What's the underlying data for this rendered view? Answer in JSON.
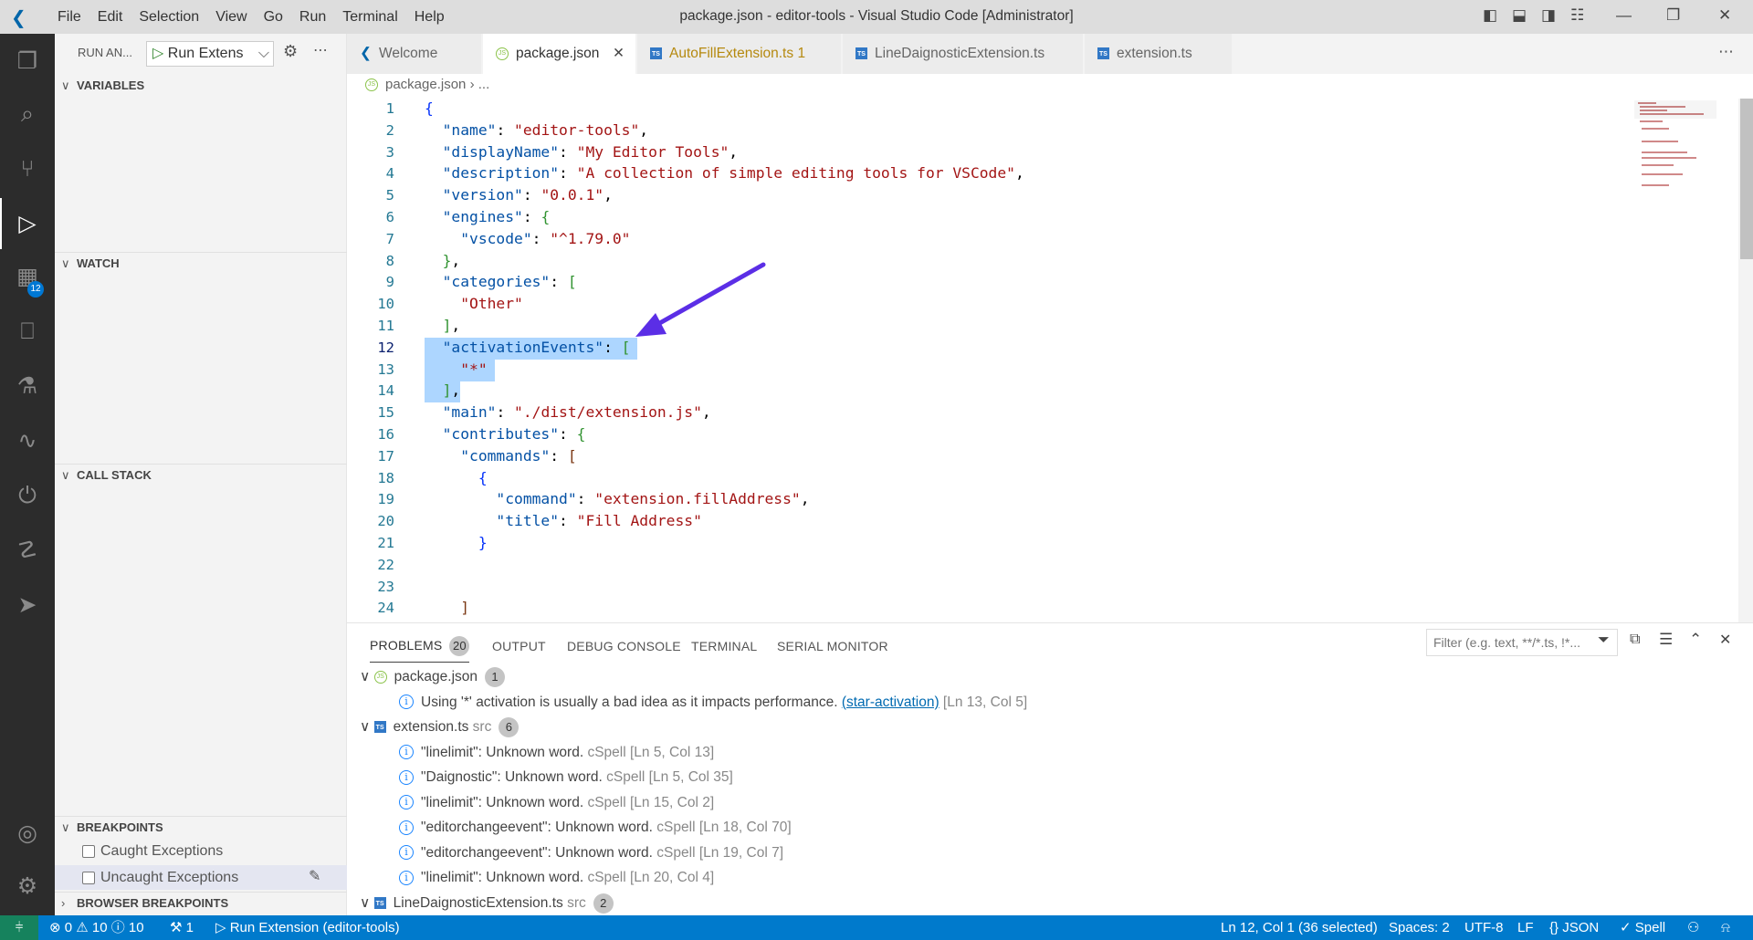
{
  "titlebar": {
    "menu": [
      "File",
      "Edit",
      "Selection",
      "View",
      "Go",
      "Run",
      "Terminal",
      "Help"
    ],
    "title": "package.json - editor-tools - Visual Studio Code [Administrator]"
  },
  "activity_bar": {
    "extensions_badge": "12",
    "items": [
      "explorer",
      "search",
      "source-control",
      "run-debug",
      "extensions",
      "remote-explorer",
      "testing",
      "serial",
      "power",
      "python",
      "deploy",
      "accounts",
      "settings"
    ]
  },
  "sidebar": {
    "title": "RUN AN...",
    "config": "Run Extens",
    "sections": {
      "variables": "VARIABLES",
      "watch": "WATCH",
      "call_stack": "CALL STACK",
      "breakpoints": "BREAKPOINTS",
      "browser_breakpoints": "BROWSER BREAKPOINTS"
    },
    "breakpoints": [
      {
        "label": "Caught Exceptions",
        "checked": false
      },
      {
        "label": "Uncaught Exceptions",
        "checked": false
      }
    ]
  },
  "tabs": [
    {
      "label": "Welcome",
      "icon": "vscode",
      "active": false
    },
    {
      "label": "package.json",
      "icon": "json",
      "active": true
    },
    {
      "label": "AutoFillExtension.ts",
      "badge": "1",
      "icon": "ts",
      "active": false
    },
    {
      "label": "LineDaignosticExtension.ts",
      "icon": "ts",
      "active": false
    },
    {
      "label": "extension.ts",
      "icon": "ts",
      "active": false
    }
  ],
  "breadcrumb": {
    "file": "package.json",
    "rest": "..."
  },
  "editor": {
    "current_line": 12,
    "selected_lines": [
      12,
      13,
      14
    ],
    "lines": [
      [
        [
          "{",
          "b1"
        ]
      ],
      [
        [
          "  ",
          ""
        ],
        [
          "\"name\"",
          "k"
        ],
        [
          ": ",
          ""
        ],
        [
          "\"editor-tools\"",
          "s"
        ],
        [
          ",",
          ""
        ]
      ],
      [
        [
          "  ",
          ""
        ],
        [
          "\"displayName\"",
          "k"
        ],
        [
          ": ",
          ""
        ],
        [
          "\"My Editor Tools\"",
          "s"
        ],
        [
          ",",
          ""
        ]
      ],
      [
        [
          "  ",
          ""
        ],
        [
          "\"description\"",
          "k"
        ],
        [
          ": ",
          ""
        ],
        [
          "\"A collection of simple editing tools for VSCode\"",
          "s"
        ],
        [
          ",",
          ""
        ]
      ],
      [
        [
          "  ",
          ""
        ],
        [
          "\"version\"",
          "k"
        ],
        [
          ": ",
          ""
        ],
        [
          "\"0.0.1\"",
          "s"
        ],
        [
          ",",
          ""
        ]
      ],
      [
        [
          "  ",
          ""
        ],
        [
          "\"engines\"",
          "k"
        ],
        [
          ": ",
          ""
        ],
        [
          "{",
          "b2"
        ]
      ],
      [
        [
          "    ",
          ""
        ],
        [
          "\"vscode\"",
          "k"
        ],
        [
          ": ",
          ""
        ],
        [
          "\"^1.79.0\"",
          "s"
        ]
      ],
      [
        [
          "  ",
          ""
        ],
        [
          "}",
          "b2"
        ],
        [
          ",",
          ""
        ]
      ],
      [
        [
          "  ",
          ""
        ],
        [
          "\"categories\"",
          "k"
        ],
        [
          ": ",
          ""
        ],
        [
          "[",
          "b2"
        ]
      ],
      [
        [
          "    ",
          ""
        ],
        [
          "\"Other\"",
          "s"
        ]
      ],
      [
        [
          "  ",
          ""
        ],
        [
          "]",
          "b2"
        ],
        [
          ",",
          ""
        ]
      ],
      [
        [
          "  ",
          ""
        ],
        [
          "\"activationEvents\"",
          "k"
        ],
        [
          ": ",
          ""
        ],
        [
          "[",
          "b2"
        ]
      ],
      [
        [
          "    ",
          ""
        ],
        [
          "\"*\"",
          "s"
        ]
      ],
      [
        [
          "  ",
          ""
        ],
        [
          "]",
          "b2"
        ],
        [
          ",",
          ""
        ]
      ],
      [
        [
          "  ",
          ""
        ],
        [
          "\"main\"",
          "k"
        ],
        [
          ": ",
          ""
        ],
        [
          "\"./dist/extension.js\"",
          "s"
        ],
        [
          ",",
          ""
        ]
      ],
      [
        [
          "  ",
          ""
        ],
        [
          "\"contributes\"",
          "k"
        ],
        [
          ": ",
          ""
        ],
        [
          "{",
          "b2"
        ]
      ],
      [
        [
          "    ",
          ""
        ],
        [
          "\"commands\"",
          "k"
        ],
        [
          ": ",
          ""
        ],
        [
          "[",
          "b3"
        ]
      ],
      [
        [
          "      ",
          ""
        ],
        [
          "{",
          "b1"
        ]
      ],
      [
        [
          "        ",
          ""
        ],
        [
          "\"command\"",
          "k"
        ],
        [
          ": ",
          ""
        ],
        [
          "\"extension.fillAddress\"",
          "s"
        ],
        [
          ",",
          ""
        ]
      ],
      [
        [
          "        ",
          ""
        ],
        [
          "\"title\"",
          "k"
        ],
        [
          ": ",
          ""
        ],
        [
          "\"Fill Address\"",
          "s"
        ]
      ],
      [
        [
          "      ",
          ""
        ],
        [
          "}",
          "b1"
        ]
      ],
      [
        [
          "",
          ""
        ]
      ],
      [
        [
          "",
          ""
        ]
      ],
      [
        [
          "    ",
          ""
        ],
        [
          "]",
          "b3"
        ]
      ]
    ],
    "annotation_arrow_color": "#5b2ee6"
  },
  "panel": {
    "tabs": [
      {
        "label": "PROBLEMS",
        "badge": "20",
        "active": true
      },
      {
        "label": "OUTPUT"
      },
      {
        "label": "DEBUG CONSOLE"
      },
      {
        "label": "TERMINAL"
      },
      {
        "label": "SERIAL MONITOR"
      }
    ],
    "filter_placeholder": "Filter (e.g. text, **/*.ts, !*...",
    "groups": [
      {
        "file": "package.json",
        "dir": "",
        "count": "1",
        "icon": "json",
        "items": [
          {
            "message": "Using '*' activation is usually a bad idea as it impacts performance.",
            "source": "(star-activation)",
            "location": "[Ln 13, Col 5]"
          }
        ]
      },
      {
        "file": "extension.ts",
        "dir": "src",
        "count": "6",
        "icon": "ts",
        "items": [
          {
            "message": "\"linelimit\": Unknown word.",
            "source": "cSpell",
            "location": "[Ln 5, Col 13]"
          },
          {
            "message": "\"Daignostic\": Unknown word.",
            "source": "cSpell",
            "location": "[Ln 5, Col 35]"
          },
          {
            "message": "\"linelimit\": Unknown word.",
            "source": "cSpell",
            "location": "[Ln 15, Col 2]"
          },
          {
            "message": "\"editorchangeevent\": Unknown word.",
            "source": "cSpell",
            "location": "[Ln 18, Col 70]"
          },
          {
            "message": "\"editorchangeevent\": Unknown word.",
            "source": "cSpell",
            "location": "[Ln 19, Col 7]"
          },
          {
            "message": "\"linelimit\": Unknown word.",
            "source": "cSpell",
            "location": "[Ln 20, Col 4]"
          }
        ]
      },
      {
        "file": "LineDaignosticExtension.ts",
        "dir": "src",
        "count": "2",
        "icon": "ts",
        "items": []
      }
    ]
  },
  "statusbar": {
    "errors": "0",
    "warnings": "10",
    "infos": "10",
    "ports": "1",
    "debug": "Run Extension (editor-tools)",
    "position": "Ln 12, Col 1 (36 selected)",
    "spaces": "Spaces: 2",
    "encoding": "UTF-8",
    "eol": "LF",
    "language": "JSON",
    "spell": "Spell",
    "colors": {
      "background": "#007acc",
      "remote": "#16825d"
    }
  }
}
